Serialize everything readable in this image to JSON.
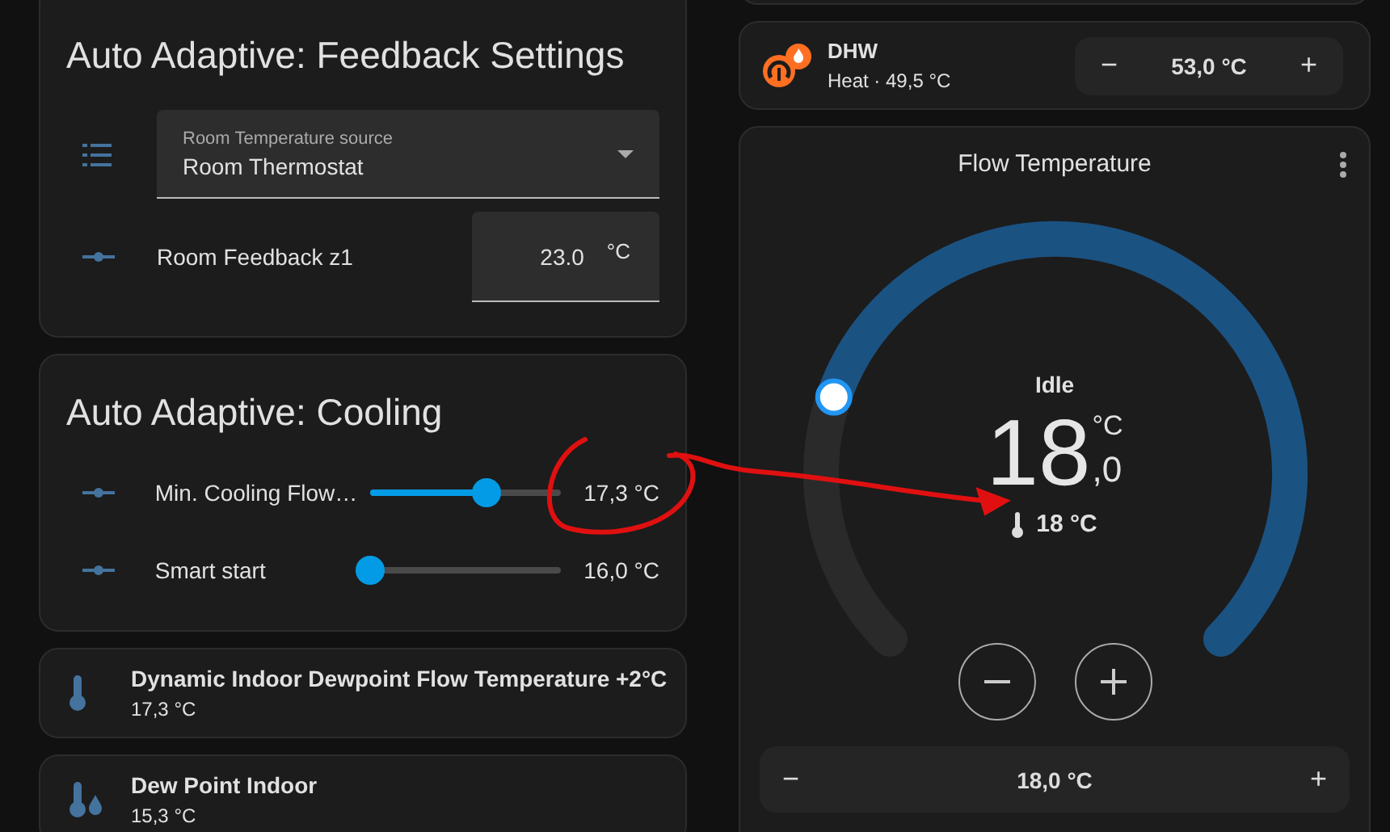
{
  "feedback_settings": {
    "title": "Auto Adaptive: Feedback Settings",
    "select": {
      "label": "Room Temperature source",
      "value": "Room Thermostat"
    },
    "number_field": {
      "label": "Room Feedback z1",
      "value": "23.0",
      "unit": "°C"
    }
  },
  "cooling": {
    "title": "Auto Adaptive: Cooling",
    "sliders": [
      {
        "name": "Min. Cooling Flow…",
        "level": 0.61,
        "reading": "17,3 °C"
      },
      {
        "name": "Smart start",
        "level": 0,
        "reading": "16,0 °C"
      }
    ]
  },
  "sensors": [
    {
      "kind": "thermometer",
      "name": "Dynamic Indoor Dewpoint Flow Temperature +2°C",
      "value": "17,3 °C"
    },
    {
      "kind": "dewpoint",
      "name": "Dew Point Indoor",
      "value": "15,3 °C"
    }
  ],
  "dhw": {
    "name": "DHW",
    "state": "Heat · 49,5 °C",
    "minus": "−",
    "target": "53,0 °C",
    "plus": "+"
  },
  "flow": {
    "title": "Flow Temperature",
    "status": "Idle",
    "target_whole": "18",
    "unit": "°C",
    "target_decimal": ",0",
    "current": "18 °C",
    "control": {
      "minus": "−",
      "value": "18,0 °C",
      "plus": "+"
    }
  }
}
